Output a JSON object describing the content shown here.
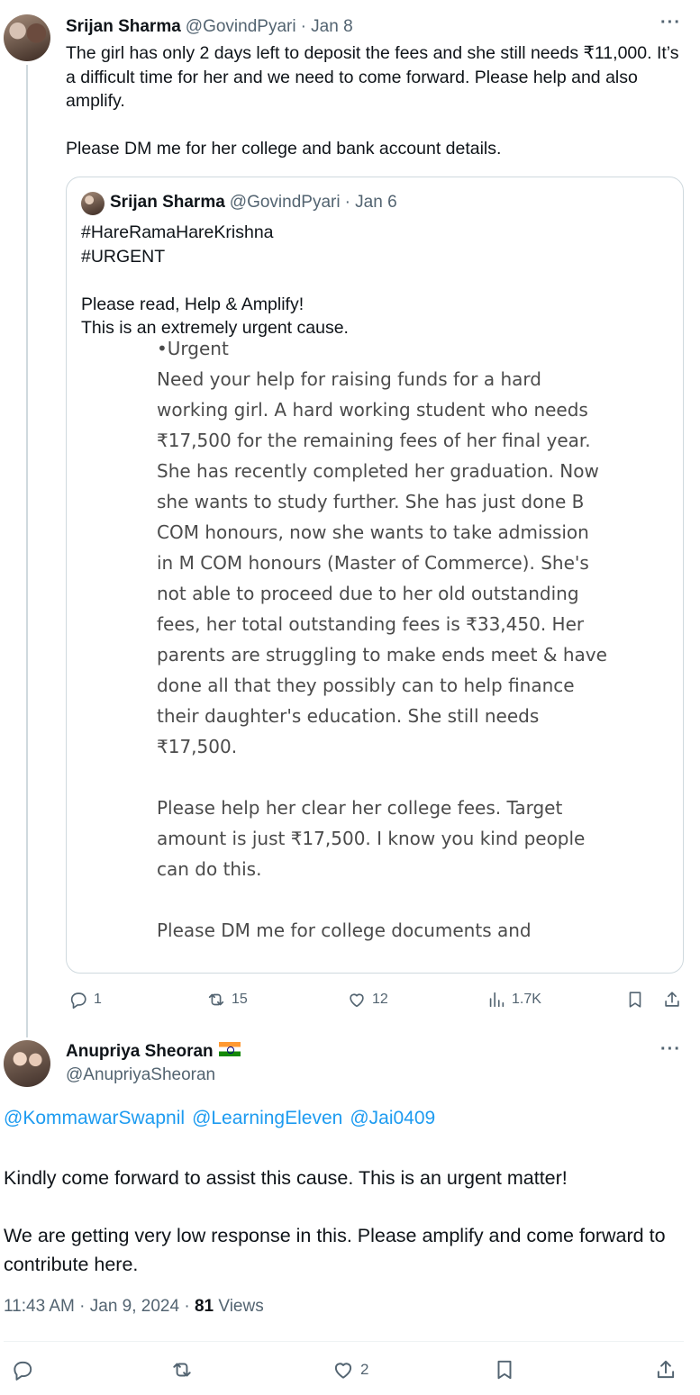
{
  "tweet1": {
    "author": "Srijan Sharma",
    "handle": "@GovindPyari",
    "date": "· Jan 8",
    "text": "The girl has only 2 days left to deposit the fees and she still needs ₹11,000. It’s a difficult time for her and we need to come forward. Please help and also amplify.\n\nPlease DM me for her college and bank account details.",
    "quote": {
      "author": "Srijan Sharma",
      "handle": "@GovindPyari",
      "date": "· Jan 6",
      "text": "#HareRamaHareKrishna\n#URGENT\n\nPlease read, Help & Amplify!\nThis is an extremely urgent cause.",
      "image_text_top": "•Urgent",
      "image_text": "Need your help for raising funds for a hard working girl. A hard working student who needs ₹17,500 for the remaining fees of her final year. She has recently completed her graduation. Now she wants to study further. She has just done B COM honours, now she wants to take admission in M COM honours (Master of Commerce). She's not able to proceed due to her old outstanding fees, her total outstanding fees is ₹33,450. Her parents are struggling to make ends meet & have done all that they possibly can to help finance their daughter's education. She still needs ₹17,500.",
      "image_text_2": "Please help her clear her college fees. Target amount is just ₹17,500. I know you kind people can do this.",
      "image_text_3": "Please DM me for college documents and"
    },
    "replies": "1",
    "reposts": "15",
    "likes": "12",
    "views": "1.7K"
  },
  "tweet2": {
    "author": "Anupriya Sheoran",
    "handle": "@AnupriyaSheoran",
    "mentions": [
      "@KommawarSwapnil",
      "@LearningEleven",
      "@Jai0409"
    ],
    "paragraph1": "Kindly come forward to assist this cause. This is an urgent matter!",
    "paragraph2": "We are getting very low response in this. Please amplify and come forward to contribute here.",
    "time": "11:43 AM · Jan 9, 2024 · ",
    "views_count": "81",
    "views_label": " Views",
    "likes": "2"
  },
  "colors": {
    "link": "#1d9bf0",
    "muted": "#536471",
    "text": "#0f1419"
  }
}
